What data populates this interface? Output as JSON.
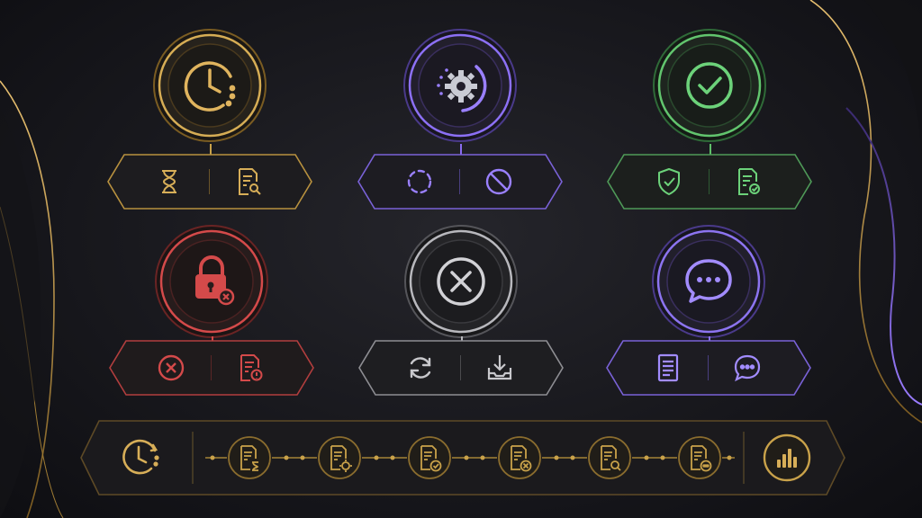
{
  "colors": {
    "gold": "#c9a24a",
    "purple": "#8a6cf0",
    "green": "#5fbf6a",
    "red": "#d24848",
    "silver": "#b8b8bc",
    "violet": "#8c74f0",
    "background": "#1b1b20"
  },
  "status_cards": [
    {
      "id": "pending",
      "accent": "gold",
      "icon": "clock-icon",
      "actions": [
        "hourglass-icon",
        "document-search-icon"
      ]
    },
    {
      "id": "processing",
      "accent": "purple",
      "icon": "gear-icon",
      "actions": [
        "loading-circle-icon",
        "block-icon"
      ]
    },
    {
      "id": "approved",
      "accent": "green",
      "icon": "check-circle-icon",
      "actions": [
        "shield-check-icon",
        "document-check-icon"
      ]
    },
    {
      "id": "locked",
      "accent": "red",
      "icon": "lock-x-icon",
      "actions": [
        "x-circle-icon",
        "document-alert-icon"
      ]
    },
    {
      "id": "cancelled",
      "accent": "silver",
      "icon": "x-circle-icon",
      "actions": [
        "refresh-icon",
        "download-tray-icon"
      ]
    },
    {
      "id": "messages",
      "accent": "violet",
      "icon": "chat-bubble-icon",
      "actions": [
        "document-lines-icon",
        "chat-bubble-icon"
      ]
    }
  ],
  "timeline": {
    "accent": "gold",
    "start_icon": "clock-history-icon",
    "steps": [
      "document-hourglass-icon",
      "document-gear-icon",
      "document-check-icon",
      "document-x-icon",
      "document-search-icon",
      "document-chat-icon"
    ],
    "end_icon": "bar-chart-icon"
  }
}
